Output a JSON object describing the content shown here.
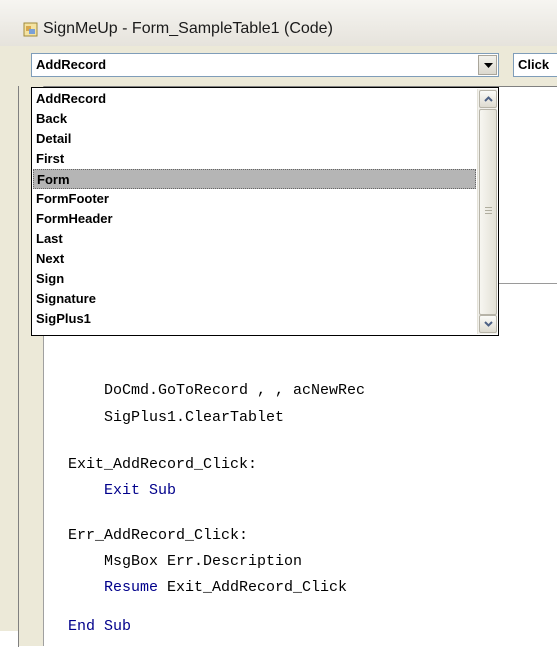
{
  "window": {
    "title": "SignMeUp - Form_SampleTable1 (Code)",
    "icon": "vba-code-icon"
  },
  "object_combo": {
    "value": "AddRecord"
  },
  "procedure_combo": {
    "value": "Click"
  },
  "dropdown": {
    "selected_index": 4,
    "items": [
      "AddRecord",
      "Back",
      "Detail",
      "First",
      "Form",
      "FormFooter",
      "FormHeader",
      "Last",
      "Next",
      "Sign",
      "Signature",
      "SigPlus1"
    ]
  },
  "code": {
    "lines": [
      {
        "text": "    DoCmd.GoToRecord , , acNewRec"
      },
      {
        "text": "    SigPlus1.ClearTablet"
      },
      {
        "text": "Exit_AddRecord_Click:"
      },
      {
        "kw": "    Exit Sub"
      },
      {
        "text": "Err_AddRecord_Click:"
      },
      {
        "text": "    MsgBox Err.Description"
      },
      {
        "kw": "    Resume",
        "text": " Exit_AddRecord_Click"
      },
      {
        "kw": "End Sub"
      }
    ]
  },
  "colors": {
    "keyword": "#00008b",
    "selection": "#b5b5b5",
    "frame": "#ece9d8"
  }
}
